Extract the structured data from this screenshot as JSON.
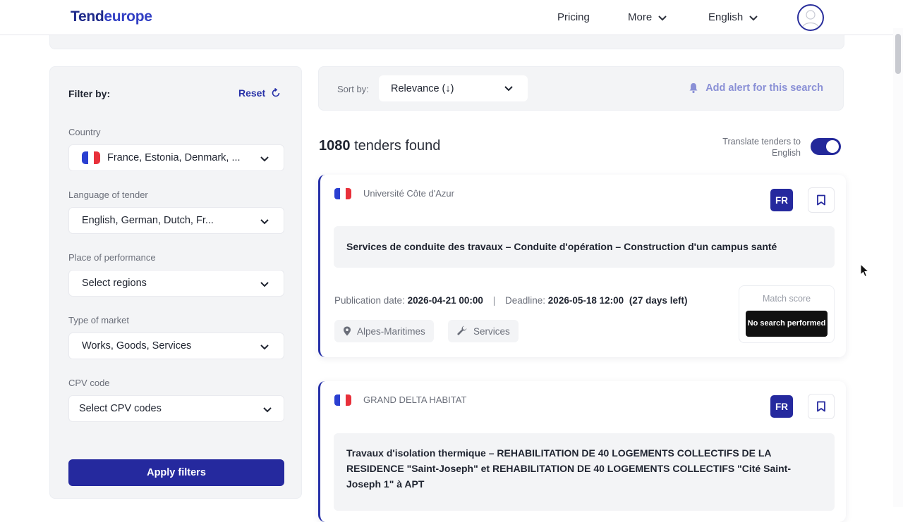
{
  "colors": {
    "brand": "#25299e",
    "accent_light": "#8a90d6",
    "panel_bg": "#f3f4f6"
  },
  "header": {
    "logo_part1": "Tend",
    "logo_part2": "europe",
    "nav": {
      "pricing": "Pricing",
      "more": "More",
      "language": "English"
    },
    "avatar_icon": "user-avatar-icon"
  },
  "sidebar": {
    "title": "Filter by:",
    "reset_label": "Reset",
    "filters": {
      "country": {
        "label": "Country",
        "value": "France, Estonia, Denmark, ..."
      },
      "language": {
        "label": "Language of tender",
        "value": "English, German, Dutch, Fr..."
      },
      "place": {
        "label": "Place of performance",
        "value": "Select regions"
      },
      "market": {
        "label": "Type of market",
        "value": "Works, Goods, Services"
      },
      "cpv": {
        "label": "CPV code",
        "value": "Select CPV codes"
      }
    },
    "apply_label": "Apply filters"
  },
  "sortbar": {
    "label": "Sort by:",
    "value": "Relevance (↓)",
    "alert_label": "Add alert for this search"
  },
  "results": {
    "count": "1080",
    "suffix": "tenders found",
    "translate_label": "Translate tenders to English",
    "translate_on": true
  },
  "tenders": [
    {
      "buyer": "Université Côte d'Azur",
      "lang": "FR",
      "title": "Services de conduite des travaux – Conduite d'opération – Construction d'un campus santé",
      "pub_label": "Publication date:",
      "pub_value": "2026-04-21 00:00",
      "sep": "|",
      "deadline_label": "Deadline:",
      "deadline_value": "2026-05-18 12:00",
      "days_left": "(27 days left)",
      "location": "Alpes-Maritimes",
      "category": "Services",
      "match_label": "Match score",
      "match_value": "No search performed"
    },
    {
      "buyer": "GRAND DELTA HABITAT",
      "lang": "FR",
      "title": "Travaux d'isolation thermique – REHABILITATION DE 40 LOGEMENTS COLLECTIFS DE LA RESIDENCE \"Saint-Joseph\" et REHABILITATION DE 40 LOGEMENTS COLLECTIFS \"Cité Saint-Joseph 1\" à APT"
    }
  ]
}
